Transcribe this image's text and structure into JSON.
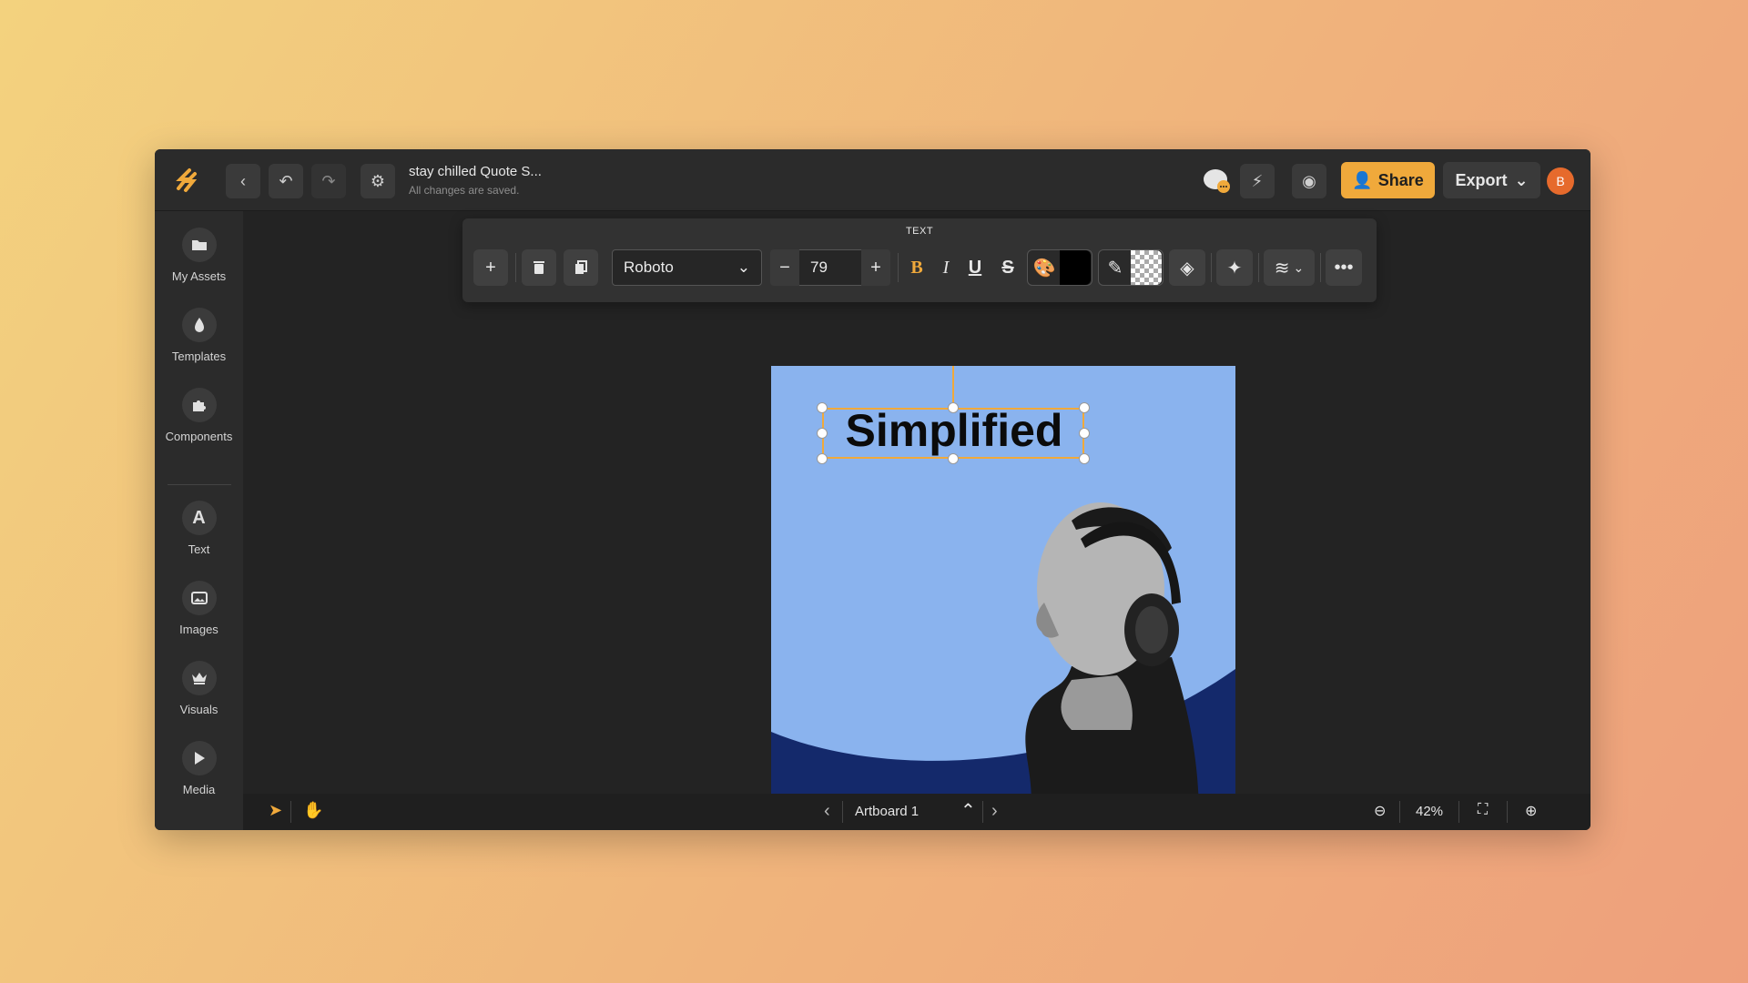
{
  "header": {
    "doc_title": "stay chilled Quote S...",
    "status": "All changes are saved.",
    "share_label": "Share",
    "export_label": "Export",
    "avatar_initial": "B"
  },
  "sidebar": {
    "items": [
      {
        "label": "My Assets",
        "icon": "folder-icon"
      },
      {
        "label": "Templates",
        "icon": "drop-icon"
      },
      {
        "label": "Components",
        "icon": "puzzle-icon"
      },
      {
        "label": "Text",
        "icon": "text-icon"
      },
      {
        "label": "Images",
        "icon": "image-icon"
      },
      {
        "label": "Visuals",
        "icon": "crown-icon"
      },
      {
        "label": "Media",
        "icon": "play-icon"
      }
    ]
  },
  "toolbar": {
    "label": "TEXT",
    "font": "Roboto",
    "font_size": "79"
  },
  "canvas": {
    "text": "Simplified"
  },
  "bottom": {
    "artboard": "Artboard 1",
    "zoom": "42%"
  },
  "colors": {
    "accent": "#f0a93b",
    "artboard_bg": "#8ab3ee",
    "wave": "#14296b",
    "text_color": "#000000"
  }
}
